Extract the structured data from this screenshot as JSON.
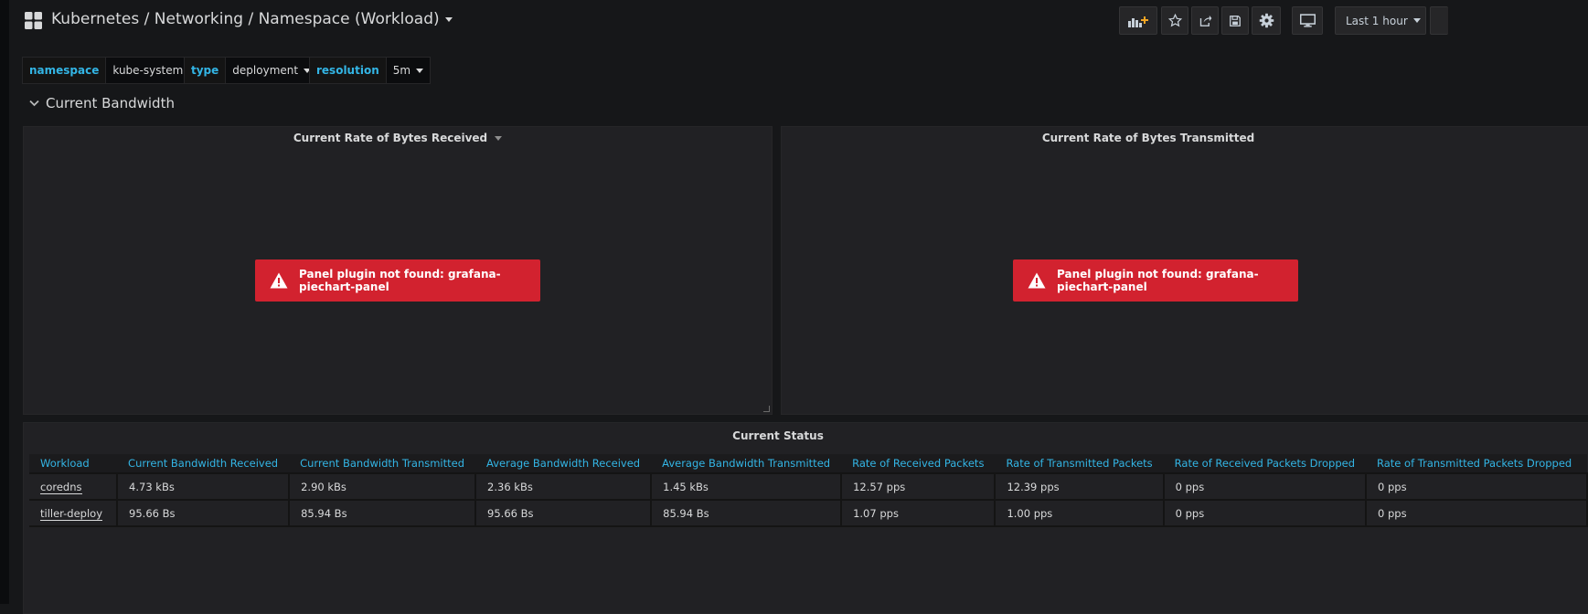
{
  "breadcrumb": "Kubernetes / Networking / Namespace (Workload)",
  "toolbar": {
    "time_range": "Last 1 hour",
    "icons": [
      "add-panel-icon",
      "star-icon",
      "share-icon",
      "save-icon",
      "gear-icon",
      "monitor-icon",
      "clock-icon"
    ]
  },
  "variables": [
    {
      "label": "namespace",
      "value": "kube-system"
    },
    {
      "label": "type",
      "value": "deployment"
    },
    {
      "label": "resolution",
      "value": "5m"
    }
  ],
  "row": {
    "title": "Current Bandwidth"
  },
  "panels": [
    {
      "title": "Current Rate of Bytes Received",
      "error": "Panel plugin not found: grafana-piechart-panel"
    },
    {
      "title": "Current Rate of Bytes Transmitted",
      "error": "Panel plugin not found: grafana-piechart-panel"
    }
  ],
  "status_panel": {
    "title": "Current Status",
    "columns": [
      "Workload",
      "Current Bandwidth Received",
      "Current Bandwidth Transmitted",
      "Average Bandwidth Received",
      "Average Bandwidth Transmitted",
      "Rate of Received Packets",
      "Rate of Transmitted Packets",
      "Rate of Received Packets Dropped",
      "Rate of Transmitted Packets Dropped"
    ],
    "rows": [
      [
        "coredns",
        "4.73 kBs",
        "2.90 kBs",
        "2.36 kBs",
        "1.45 kBs",
        "12.57 pps",
        "12.39 pps",
        "0 pps",
        "0 pps"
      ],
      [
        "tiller-deploy",
        "95.66 Bs",
        "85.94 Bs",
        "95.66 Bs",
        "85.94 Bs",
        "1.07 pps",
        "1.00 pps",
        "0 pps",
        "0 pps"
      ]
    ]
  },
  "colors": {
    "accent": "#33b5e5",
    "error": "#d2222f",
    "background": "#161719",
    "panel": "#212124"
  }
}
